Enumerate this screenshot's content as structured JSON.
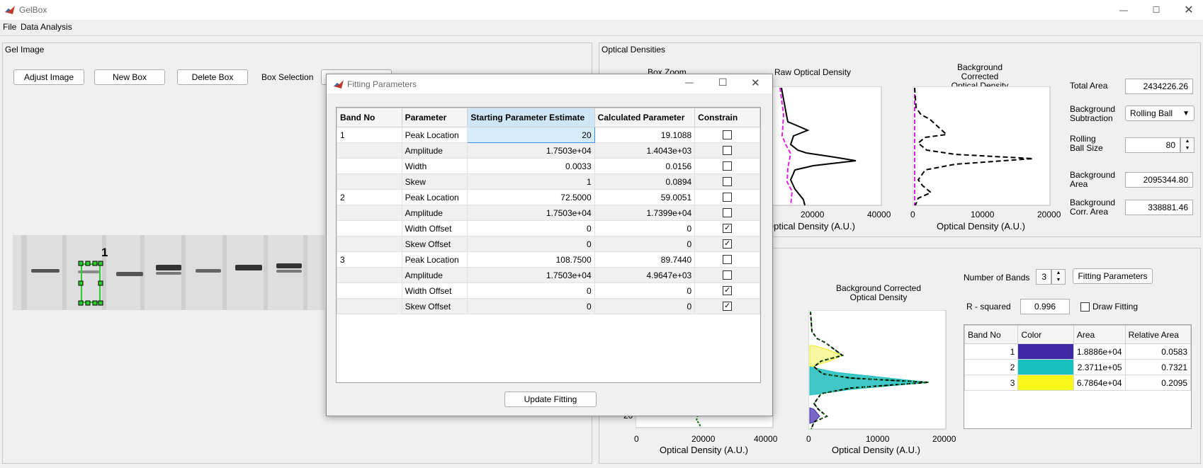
{
  "app": {
    "title": "GelBox"
  },
  "menu": {
    "file": "File",
    "data_analysis": "Data Analysis"
  },
  "gel_panel": {
    "title": "Gel Image",
    "adjust_image": "Adjust Image",
    "new_box": "New Box",
    "delete_box": "Delete Box",
    "box_selection_label": "Box Selection",
    "box_label": "1"
  },
  "od_panel": {
    "title": "Optical Densities",
    "box_zoom_title": "Box Zoom",
    "raw_od_title": "Raw Optical Density",
    "bg_corr_title_1": "Background Corrected",
    "bg_corr_title_2": "Optical Density",
    "raw_xticks": [
      "20000",
      "40000"
    ],
    "raw_xlabel": "Optical Density (A.U.)",
    "bg_xticks": [
      "0",
      "10000",
      "20000"
    ],
    "bg_xlabel": "Optical Density (A.U.)",
    "total_area_label": "Total Area",
    "total_area": "2434226.26",
    "bg_sub_label_1": "Background",
    "bg_sub_label_2": "Subtraction",
    "bg_sub_value": "Rolling Ball",
    "rolling_label_1": "Rolling",
    "rolling_label_2": "Ball Size",
    "rolling_value": "80",
    "bg_area_label_1": "Background",
    "bg_area_label_2": "Area",
    "bg_area": "2095344.80",
    "bg_corr_area_label_1": "Background",
    "bg_corr_area_label_2": "Corr. Area",
    "bg_corr_area": "338881.46"
  },
  "fit_panel": {
    "num_bands_label": "Number of Bands",
    "num_bands": "3",
    "fitting_params_btn": "Fitting Parameters",
    "rsq_label": "R - squared",
    "rsq_value": "0.996",
    "draw_fitting": "Draw Fitting",
    "plot1_xticks": [
      "0",
      "20000",
      "40000"
    ],
    "plot1_ytick": "20",
    "plot1_xlabel": "Optical Density (A.U.)",
    "plot2_title_1": "Background Corrected",
    "plot2_title_2": "Optical Density",
    "plot2_xticks": [
      "0",
      "10000",
      "20000"
    ],
    "plot2_xlabel": "Optical Density (A.U.)",
    "band_table": {
      "headers": [
        "Band No",
        "Color",
        "Area",
        "Relative Area"
      ],
      "rows": [
        {
          "band": "1",
          "color": "#3f27a6",
          "area": "1.8886e+04",
          "rel": "0.0583"
        },
        {
          "band": "2",
          "color": "#19c0c0",
          "area": "2.3711e+05",
          "rel": "0.7321"
        },
        {
          "band": "3",
          "color": "#f7f719",
          "area": "6.7864e+04",
          "rel": "0.2095"
        }
      ]
    }
  },
  "dialog": {
    "title": "Fitting Parameters",
    "headers": [
      "Band No",
      "Parameter",
      "Starting Parameter Estimate",
      "Calculated Parameter",
      "Constrain"
    ],
    "rows": [
      {
        "band": "1",
        "param": "Peak Location",
        "start": "20",
        "calc": "19.1088",
        "checked": false
      },
      {
        "band": "",
        "param": "Amplitude",
        "start": "1.7503e+04",
        "calc": "1.4043e+03",
        "checked": false
      },
      {
        "band": "",
        "param": "Width",
        "start": "0.0033",
        "calc": "0.0156",
        "checked": false
      },
      {
        "band": "",
        "param": "Skew",
        "start": "1",
        "calc": "0.0894",
        "checked": false
      },
      {
        "band": "2",
        "param": "Peak Location",
        "start": "72.5000",
        "calc": "59.0051",
        "checked": false
      },
      {
        "band": "",
        "param": "Amplitude",
        "start": "1.7503e+04",
        "calc": "1.7399e+04",
        "checked": false
      },
      {
        "band": "",
        "param": "Width Offset",
        "start": "0",
        "calc": "0",
        "checked": true
      },
      {
        "band": "",
        "param": "Skew Offset",
        "start": "0",
        "calc": "0",
        "checked": true
      },
      {
        "band": "3",
        "param": "Peak Location",
        "start": "108.7500",
        "calc": "89.7440",
        "checked": false
      },
      {
        "band": "",
        "param": "Amplitude",
        "start": "1.7503e+04",
        "calc": "4.9647e+03",
        "checked": false
      },
      {
        "band": "",
        "param": "Width Offset",
        "start": "0",
        "calc": "0",
        "checked": true
      },
      {
        "band": "",
        "param": "Skew Offset",
        "start": "0",
        "calc": "0",
        "checked": true
      }
    ],
    "update_btn": "Update Fitting"
  },
  "colors": {
    "accent": "#3a8ee6",
    "box_green": "#2ecc2e",
    "magenta": "#e020e0"
  }
}
